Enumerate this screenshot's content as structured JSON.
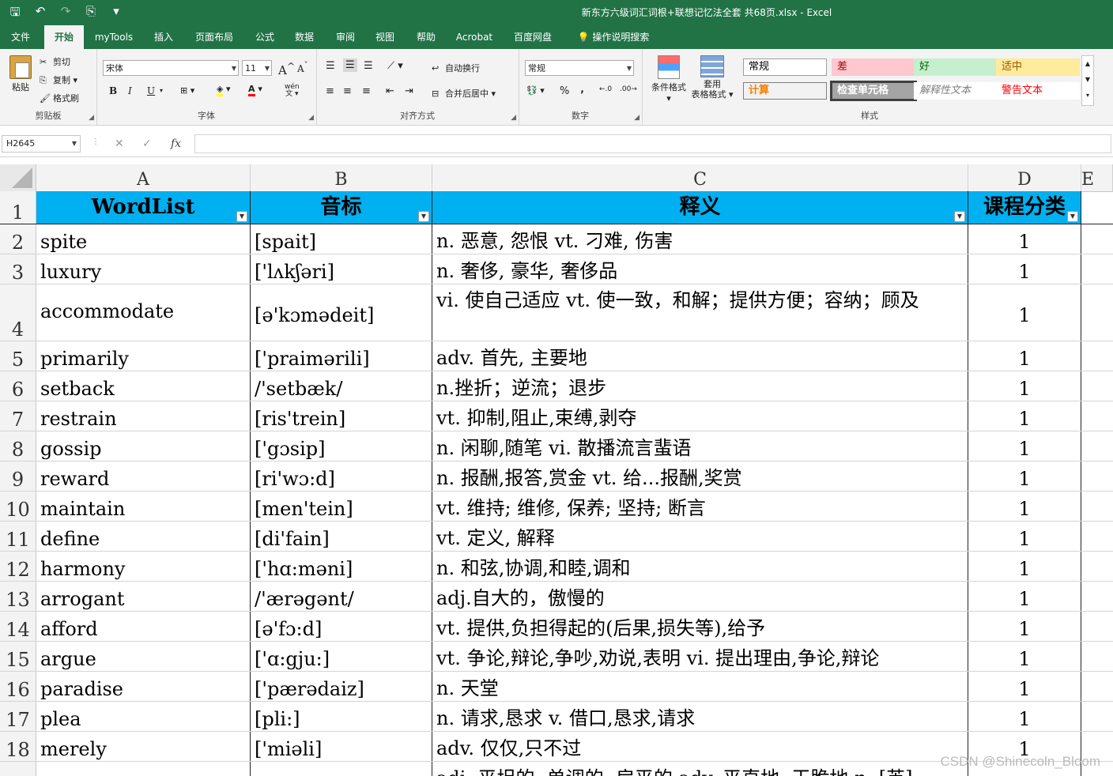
{
  "window": {
    "title": "新东方六级词汇词根+联想记忆法全套 共68页.xlsx  -  Excel"
  },
  "qat": {
    "save": "🖫",
    "undo": "↶",
    "redo": "↷",
    "touch": "⎘",
    "more": "▾"
  },
  "menu_tabs": [
    "文件",
    "开始",
    "myTools",
    "插入",
    "页面布局",
    "公式",
    "数据",
    "审阅",
    "视图",
    "帮助",
    "Acrobat",
    "百度网盘",
    "操作说明搜索"
  ],
  "ribbon": {
    "clipboard": {
      "paste": "粘贴",
      "cut": "剪切",
      "copy": "复制",
      "format_painter": "格式刷",
      "label": "剪贴板"
    },
    "font": {
      "name": "宋体",
      "size": "11",
      "bold": "B",
      "italic": "I",
      "underline": "U",
      "grow": "A",
      "shrink": "A",
      "wen": "wén",
      "label": "字体"
    },
    "alignment": {
      "wrap_text": "自动换行",
      "merge_center": "合并后居中",
      "label": "对齐方式"
    },
    "number": {
      "format": "常规",
      "percent": "%",
      "comma": "‚",
      "label": "数字"
    },
    "styles": {
      "conditional": "条件格式",
      "table_line1": "套用",
      "table_line2": "表格格式",
      "cells": [
        {
          "text": "常规",
          "bg": "#ffffff",
          "fg": "#000000",
          "border": "#9e9e9e"
        },
        {
          "text": "差",
          "bg": "#ffc7ce",
          "fg": "#9c0006",
          "border": "#ffc7ce"
        },
        {
          "text": "好",
          "bg": "#c6efce",
          "fg": "#006100",
          "border": "#c6efce"
        },
        {
          "text": "适中",
          "bg": "#ffeb9c",
          "fg": "#9c5700",
          "border": "#ffeb9c"
        },
        {
          "text": "计算",
          "bg": "#f2f2f2",
          "fg": "#fa7d00",
          "border": "#7f7f7f"
        },
        {
          "text": "检查单元格",
          "bg": "#a5a5a5",
          "fg": "#ffffff",
          "border": "#3f3f3f"
        },
        {
          "text": "解释性文本",
          "bg": "#ffffff",
          "fg": "#7f7f7f",
          "border": "#ffffff"
        },
        {
          "text": "警告文本",
          "bg": "#ffffff",
          "fg": "#ff0000",
          "border": "#ffffff"
        }
      ],
      "label": "样式"
    }
  },
  "formula_bar": {
    "name_box": "H2645",
    "cancel": "✕",
    "enter": "✓",
    "fx": "fx",
    "value": ""
  },
  "columns": [
    "A",
    "B",
    "C",
    "D",
    "E"
  ],
  "header_row": {
    "num": "1",
    "a": "WordList",
    "b": "音标",
    "c": "释义",
    "d": "课程分类"
  },
  "rows": [
    {
      "num": "2",
      "word": "spite",
      "phonetic": "[spait]",
      "meaning": "n. 恶意, 怨恨 vt. 刁难, 伤害",
      "cat": "1"
    },
    {
      "num": "3",
      "word": "luxury",
      "phonetic": "['lʌkʃəri]",
      "meaning": "n. 奢侈, 豪华, 奢侈品",
      "cat": "1"
    },
    {
      "num": "4",
      "word": "accommodate",
      "phonetic": "[ə'kɔmədeit]",
      "meaning": "vi. 使自己适应 vt. 使一致，和解；提供方便；容纳；顾及",
      "cat": "1"
    },
    {
      "num": "5",
      "word": "primarily",
      "phonetic": "['praimərili]",
      "meaning": "adv. 首先, 主要地",
      "cat": "1"
    },
    {
      "num": "6",
      "word": "setback",
      "phonetic": "/'setbæk/",
      "meaning": "n.挫折；逆流；退步",
      "cat": "1"
    },
    {
      "num": "7",
      "word": "restrain",
      "phonetic": "[ris'trein]",
      "meaning": "vt. 抑制,阻止,束缚,剥夺",
      "cat": "1"
    },
    {
      "num": "8",
      "word": "gossip",
      "phonetic": "['gɔsip]",
      "meaning": "n. 闲聊,随笔 vi. 散播流言蜚语",
      "cat": "1"
    },
    {
      "num": "9",
      "word": "reward",
      "phonetic": "[ri'wɔ:d]",
      "meaning": "n. 报酬,报答,赏金 vt. 给...报酬,奖赏",
      "cat": "1"
    },
    {
      "num": "10",
      "word": "maintain",
      "phonetic": "[men'tein]",
      "meaning": "vt. 维持; 维修, 保养; 坚持; 断言",
      "cat": "1"
    },
    {
      "num": "11",
      "word": "define",
      "phonetic": "[di'fain]",
      "meaning": "vt. 定义, 解释",
      "cat": "1"
    },
    {
      "num": "12",
      "word": "harmony",
      "phonetic": "['hɑ:məni]",
      "meaning": "n. 和弦,协调,和睦,调和",
      "cat": "1"
    },
    {
      "num": "13",
      "word": "arrogant",
      "phonetic": "/'ærəgənt/",
      "meaning": "adj.自大的，傲慢的",
      "cat": "1"
    },
    {
      "num": "14",
      "word": "afford",
      "phonetic": "[ə'fɔ:d]",
      "meaning": "vt. 提供,负担得起的(后果,损失等),给予",
      "cat": "1"
    },
    {
      "num": "15",
      "word": "argue",
      "phonetic": "['ɑ:gju:]",
      "meaning": "vt. 争论,辩论,争吵,劝说,表明 vi. 提出理由,争论,辩论",
      "cat": "1"
    },
    {
      "num": "16",
      "word": "paradise",
      "phonetic": "['pærədaiz]",
      "meaning": "n. 天堂",
      "cat": "1"
    },
    {
      "num": "17",
      "word": "plea",
      "phonetic": "[pli:]",
      "meaning": "n. 请求,恳求 v. 借口,恳求,请求",
      "cat": "1"
    },
    {
      "num": "18",
      "word": "merely",
      "phonetic": "['miəli]",
      "meaning": "adv. 仅仅,只不过",
      "cat": "1"
    },
    {
      "num": "",
      "word": "",
      "phonetic": "",
      "meaning": "adj. 平坦的, 单调的, 扁平的 adv. 平直地, 干脆地 n. [英]",
      "cat": ""
    }
  ],
  "watermark": "CSDN @Shinecoln_Bloom"
}
